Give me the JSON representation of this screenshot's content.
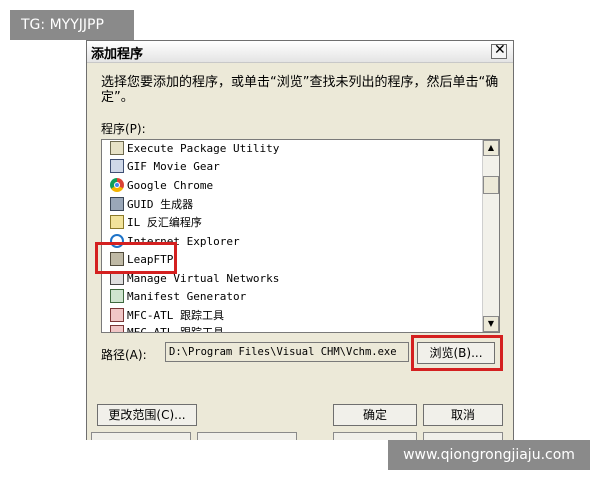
{
  "watermark_top": "TG: MYYJJPP",
  "watermark_bottom": "www.qiongrongjiaju.com",
  "dialog": {
    "title": "添加程序",
    "close_symbol": "✕",
    "instruction": "选择您要添加的程序，或单击“浏览”查找未列出的程序，然后单击“确定”。",
    "programs_label": "程序(P):",
    "programs": [
      {
        "label": "Execute Package Utility",
        "icon": "package-icon"
      },
      {
        "label": "GIF Movie Gear",
        "icon": "gif-icon"
      },
      {
        "label": "Google Chrome",
        "icon": "chrome-icon"
      },
      {
        "label": "GUID 生成器",
        "icon": "guid-icon"
      },
      {
        "label": "IL 反汇编程序",
        "icon": "il-icon"
      },
      {
        "label": "Internet Explorer",
        "icon": "ie-icon"
      },
      {
        "label": "LeapFTP",
        "icon": "ftp-icon"
      },
      {
        "label": "Manage Virtual Networks",
        "icon": "network-icon"
      },
      {
        "label": "Manifest Generator",
        "icon": "manifest-icon"
      },
      {
        "label": "MFC-ATL 跟踪工具",
        "icon": "mfc-icon"
      },
      {
        "label": "MFC-ATL 跟踪工具",
        "icon": "mfc-icon"
      }
    ],
    "path_label": "路径(A):",
    "path_value": "D:\\Program Files\\Visual CHM\\Vchm.exe",
    "browse_label": "浏览(B)...",
    "change_scope_label": "更改范围(C)...",
    "ok_label": "确定",
    "cancel_label": "取消"
  }
}
